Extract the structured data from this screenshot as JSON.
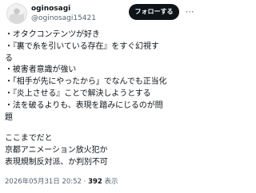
{
  "user": {
    "display_name": "oginosagi",
    "handle": "@oginosagi15421"
  },
  "header": {
    "follow_label": "フォローする",
    "more_icon": "ellipsis-icon"
  },
  "body": {
    "lines": [
      "・オタクコンテンツが好き",
      "・『裏で糸を引いている存在』をすぐ幻視す",
      "る",
      "・被害者意識が強い",
      "・「相手が先にやったから」でなんでも正当化",
      "・『炎上させる』ことで解決しようとする",
      "・法を破るよりも、表現を踏みにじるのが問",
      "題"
    ],
    "closing_lines": [
      "ここまでだと",
      "京都アニメーション放火犯か",
      "表現規制反対派、か判別不可"
    ]
  },
  "meta": {
    "timestamp": "2026年05月31日 20:52",
    "separator": "·",
    "views_count": "392",
    "views_label": "表示"
  }
}
